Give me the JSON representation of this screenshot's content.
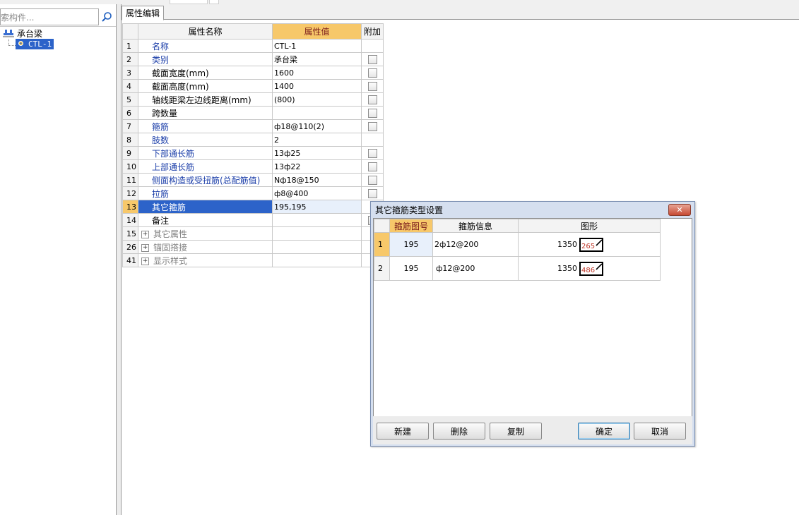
{
  "left_panel": {
    "search_placeholder": "索构件...",
    "tree": {
      "root_label": "承台梁",
      "child_label": "CTL-1"
    }
  },
  "tabs": [
    {
      "label": "属性编辑"
    }
  ],
  "property_grid": {
    "headers": {
      "name": "属性名称",
      "value": "属性值",
      "extra": "附加"
    },
    "rows": [
      {
        "num": "1",
        "name": "名称",
        "value": "CTL-1",
        "checkbox": false,
        "style": "blue"
      },
      {
        "num": "2",
        "name": "类别",
        "value": "承台梁",
        "checkbox": true,
        "style": "blue"
      },
      {
        "num": "3",
        "name": "截面宽度(mm)",
        "value": "1600",
        "checkbox": true,
        "style": "plain"
      },
      {
        "num": "4",
        "name": "截面高度(mm)",
        "value": "1400",
        "checkbox": true,
        "style": "plain"
      },
      {
        "num": "5",
        "name": "轴线距梁左边线距离(mm)",
        "value": "(800)",
        "checkbox": true,
        "style": "plain"
      },
      {
        "num": "6",
        "name": "跨数量",
        "value": "",
        "checkbox": true,
        "style": "plain"
      },
      {
        "num": "7",
        "name": "箍筋",
        "value": "ф18@110(2)",
        "checkbox": true,
        "style": "blue"
      },
      {
        "num": "8",
        "name": "肢数",
        "value": "2",
        "checkbox": false,
        "style": "blue"
      },
      {
        "num": "9",
        "name": "下部通长筋",
        "value": "13ф25",
        "checkbox": true,
        "style": "blue"
      },
      {
        "num": "10",
        "name": "上部通长筋",
        "value": "13ф22",
        "checkbox": true,
        "style": "blue"
      },
      {
        "num": "11",
        "name": "侧面构造或受扭筋(总配筋值)",
        "value": "Nф18@150",
        "checkbox": true,
        "style": "blue"
      },
      {
        "num": "12",
        "name": "拉筋",
        "value": "ф8@400",
        "checkbox": true,
        "style": "blue"
      },
      {
        "num": "13",
        "name": "其它箍筋",
        "value": "195,195",
        "checkbox": false,
        "style": "selected"
      },
      {
        "num": "14",
        "name": "备注",
        "value": "",
        "checkbox": true,
        "style": "plain"
      },
      {
        "num": "15",
        "name": "其它属性",
        "value": "",
        "checkbox": false,
        "style": "group"
      },
      {
        "num": "26",
        "name": "锚固搭接",
        "value": "",
        "checkbox": false,
        "style": "group"
      },
      {
        "num": "41",
        "name": "显示样式",
        "value": "",
        "checkbox": false,
        "style": "group"
      }
    ]
  },
  "dialog": {
    "title": "其它箍筋类型设置",
    "close_label": "✕",
    "table": {
      "headers": {
        "shape_no": "箍筋图号",
        "info": "箍筋信息",
        "figure": "图形"
      },
      "rows": [
        {
          "num": "1",
          "shape_no": "195",
          "info": "2ф12@200",
          "length": "1350",
          "hook": "265"
        },
        {
          "num": "2",
          "shape_no": "195",
          "info": "ф12@200",
          "length": "1350",
          "hook": "486"
        }
      ]
    },
    "buttons": {
      "new": "新建",
      "delete": "删除",
      "copy": "复制",
      "ok": "确定",
      "cancel": "取消"
    }
  }
}
